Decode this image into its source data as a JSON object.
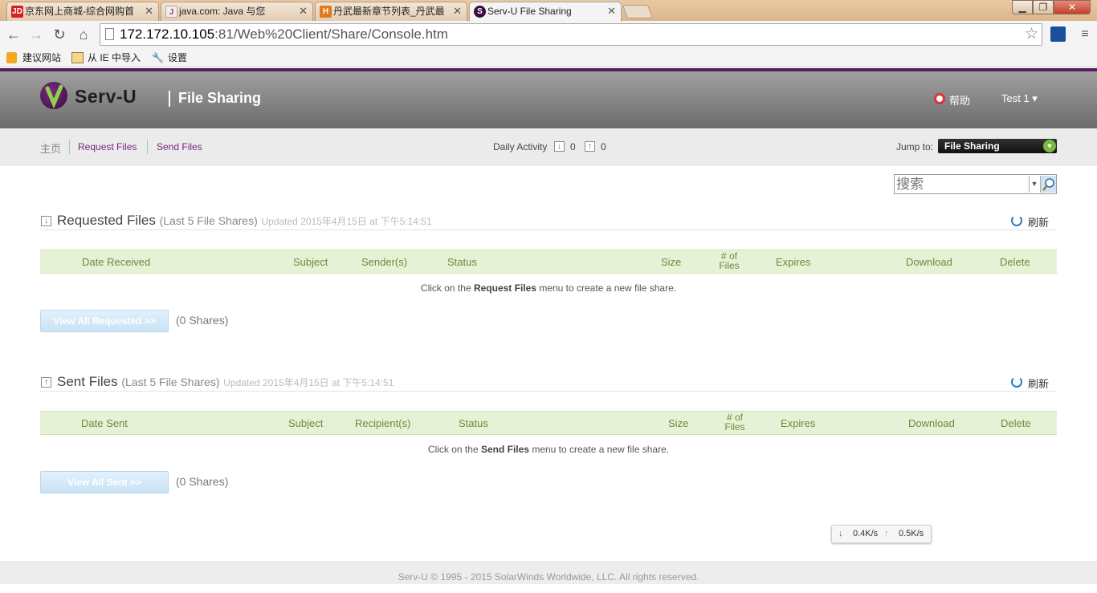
{
  "browser": {
    "tabs": [
      {
        "label": "京东网上商城-综合网购首",
        "favicon": "JD",
        "color": "#d62020"
      },
      {
        "label": "java.com: Java 与您",
        "favicon": "J",
        "color": "#e8e8e8"
      },
      {
        "label": "丹武最新章节列表_丹武最",
        "favicon": "H",
        "color": "#e06020"
      },
      {
        "label": "Serv-U File Sharing",
        "favicon": "S",
        "color": "#3a0c3d"
      }
    ],
    "url_host": "172.172.10.105",
    "url_rest": ":81/Web%20Client/Share/Console.htm",
    "bookmarks": [
      "建议网站",
      "从 IE 中导入",
      "设置"
    ]
  },
  "header": {
    "logo_text": "Serv-U",
    "app_title": "File Sharing",
    "help": "帮助",
    "user": "Test 1 ▾"
  },
  "subnav": {
    "home": "主页",
    "request_files": "Request Files",
    "send_files": "Send Files",
    "daily_activity": "Daily Activity",
    "down_count": "0",
    "up_count": "0",
    "jump_to_label": "Jump to:",
    "jump_to_value": "File Sharing"
  },
  "search": {
    "placeholder": "搜索"
  },
  "requested": {
    "title": "Requested Files",
    "subtitle": "(Last 5 File Shares)",
    "updated": "Updated 2015年4月15日 at 下午5:14:51",
    "refresh": "刷新",
    "columns": {
      "date": "Date Received",
      "subject": "Subject",
      "party": "Sender(s)",
      "status": "Status",
      "size": "Size",
      "files": "# of Files",
      "expires": "Expires",
      "download": "Download",
      "delete": "Delete"
    },
    "empty_pre": "Click on the ",
    "empty_bold": "Request Files",
    "empty_post": " menu to create a new file share.",
    "view_all": "View All Requested >>",
    "shares": "(0 Shares)"
  },
  "sent": {
    "title": "Sent Files",
    "subtitle": "(Last 5 File Shares)",
    "updated": "Updated 2015年4月15日 at 下午5:14:51",
    "refresh": "刷新",
    "columns": {
      "date": "Date Sent",
      "subject": "Subject",
      "party": "Recipient(s)",
      "status": "Status",
      "size": "Size",
      "files": "# of Files",
      "expires": "Expires",
      "download": "Download",
      "delete": "Delete"
    },
    "empty_pre": "Click on the ",
    "empty_bold": "Send Files",
    "empty_post": " menu to create a new file share.",
    "view_all": "View All Sent >>",
    "shares": "(0 Shares)"
  },
  "speed": {
    "down": "0.4K/s",
    "up": "0.5K/s"
  },
  "footer": "Serv-U © 1995 - 2015 SolarWinds Worldwide, LLC. All rights reserved."
}
